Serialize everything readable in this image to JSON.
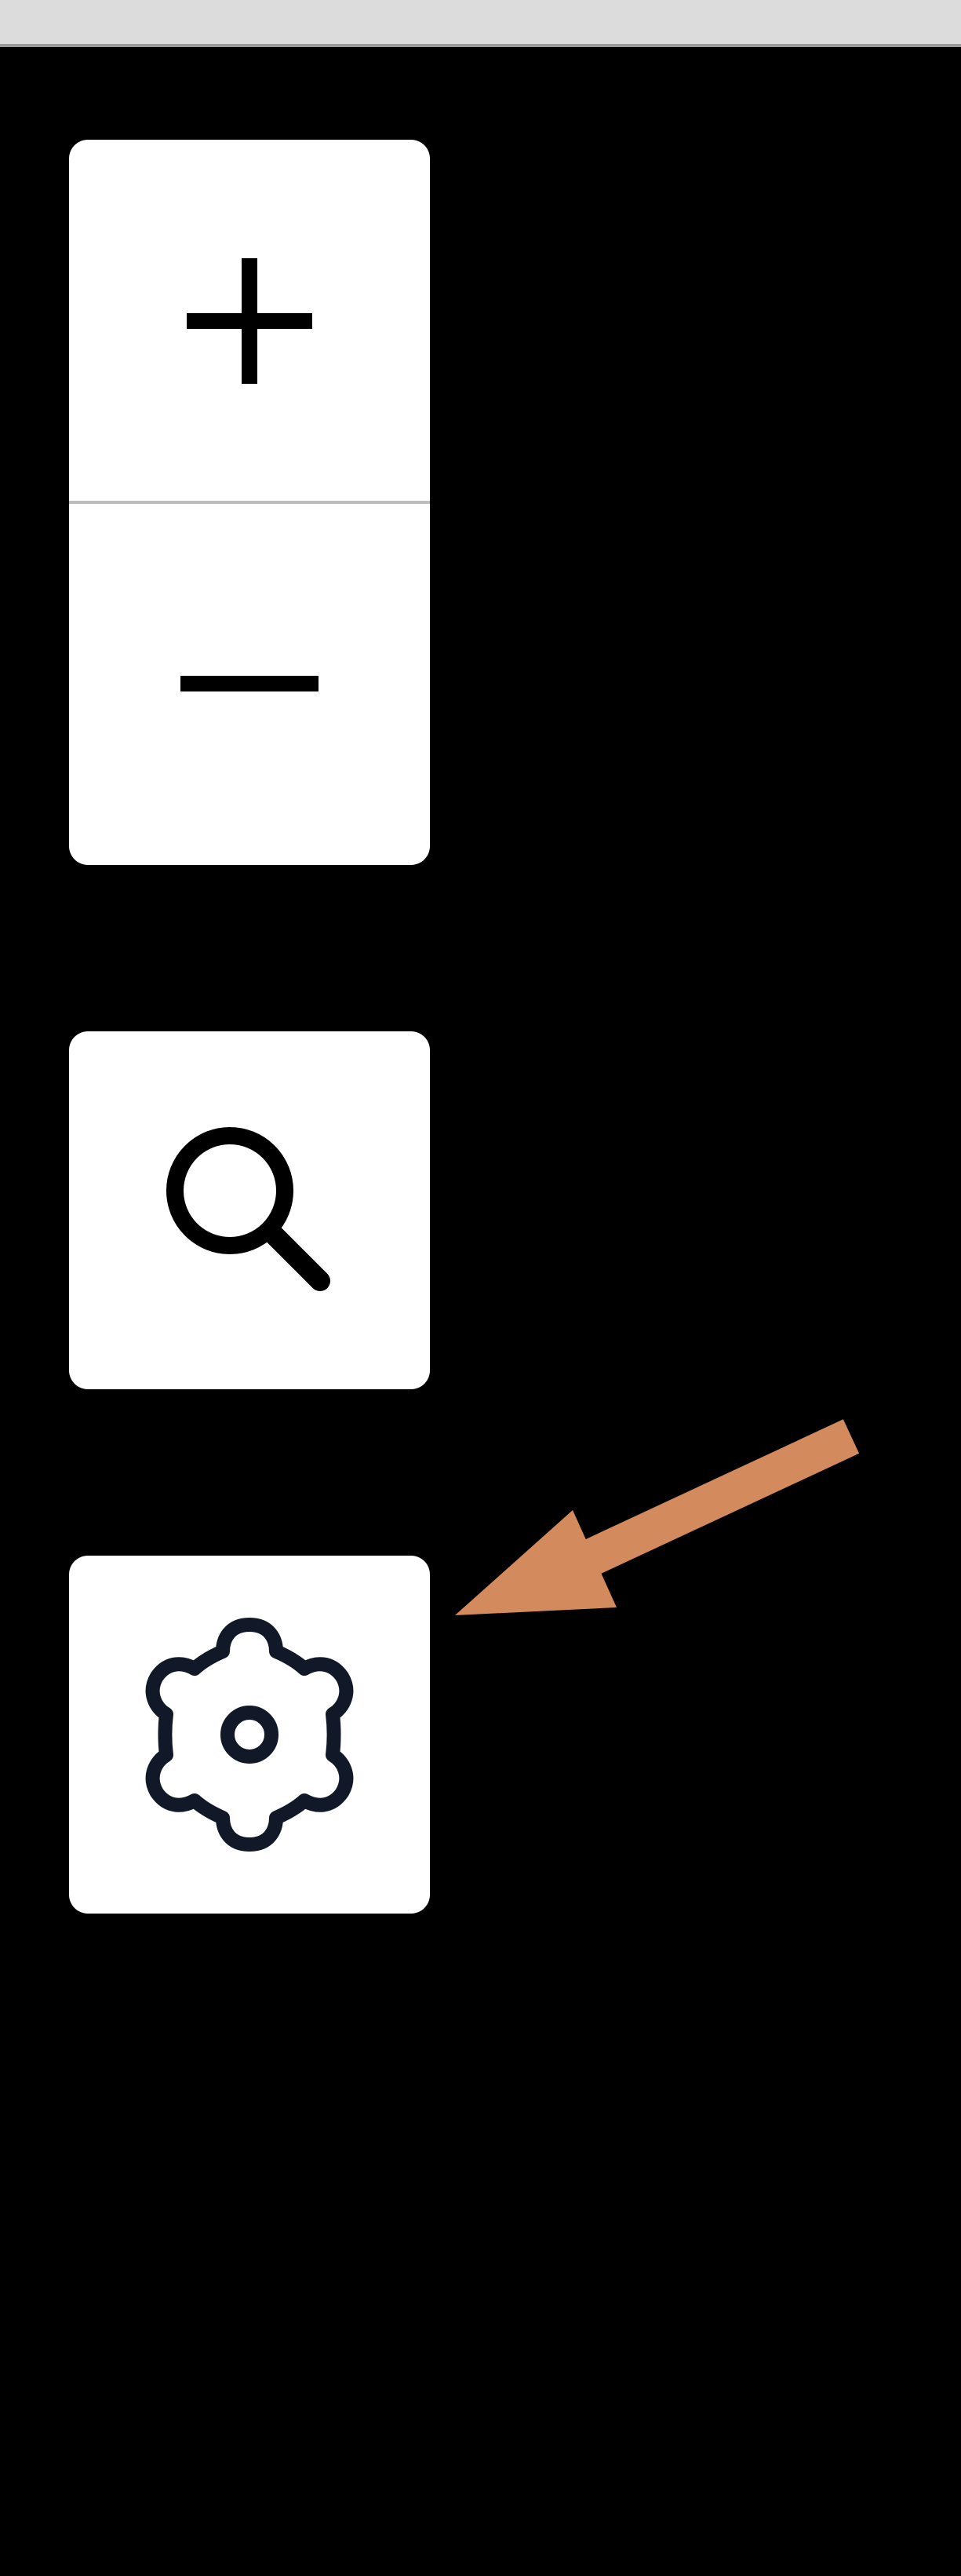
{
  "window": {
    "top_bar_color": "#dcdcdc",
    "background_color": "#000000"
  },
  "map_controls": {
    "zoom_in": {
      "icon": "plus-icon"
    },
    "zoom_out": {
      "icon": "minus-icon"
    },
    "search": {
      "icon": "search-icon"
    },
    "settings": {
      "icon": "gear-icon"
    }
  },
  "annotation": {
    "arrow_color": "#d38b5d",
    "points_to": "settings-button"
  }
}
